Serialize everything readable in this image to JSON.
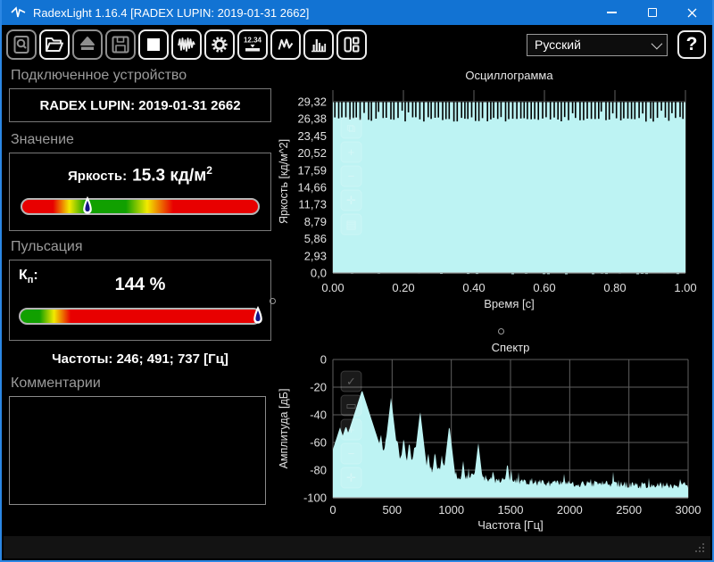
{
  "window": {
    "title": "RadexLight 1.16.4 [RADEX LUPIN: 2019-01-31 2662]",
    "controls": [
      {
        "name": "minimize"
      },
      {
        "name": "maximize"
      },
      {
        "name": "close"
      }
    ]
  },
  "toolbar": {
    "buttons": [
      {
        "name": "report-search",
        "enabled": false
      },
      {
        "name": "open-file",
        "enabled": true
      },
      {
        "name": "eject-device",
        "enabled": false
      },
      {
        "name": "save",
        "enabled": false
      },
      {
        "name": "stop",
        "enabled": true
      },
      {
        "name": "oscillogram-mode",
        "enabled": true
      },
      {
        "name": "settings-gear",
        "enabled": true
      },
      {
        "name": "numeric-display",
        "enabled": true,
        "text": "12.34"
      },
      {
        "name": "waveform-view",
        "enabled": true
      },
      {
        "name": "spectrum-view",
        "enabled": true
      },
      {
        "name": "layout-panels",
        "enabled": true
      }
    ],
    "language": "Русский",
    "help_label": "?"
  },
  "device": {
    "label": "Подключенное устройство",
    "value": "RADEX LUPIN: 2019-01-31 2662"
  },
  "value_section": {
    "label": "Значение",
    "param": "Яркость:",
    "value": "15.3",
    "unit": "кд/м",
    "unit_sup": "2",
    "marker_pos": 0.28
  },
  "pulsation": {
    "label": "Пульсация",
    "kp_main": "К",
    "kp_sub": "п",
    "kp_suffix": ":",
    "value": "144 %",
    "marker_pos": 0.985,
    "freq_text": "Частоты: 246; 491; 737 [Гц]"
  },
  "comments": {
    "label": "Комментарии",
    "text": ""
  },
  "colors": {
    "titlebar": "#1273d3",
    "window_border": "#2b87e4",
    "fill_cyan": "#bdf3f3",
    "grid": "#5f5f5f",
    "axis": "#9a9a9a",
    "green": "#11a000",
    "yellow": "#f2ea00",
    "red": "#e80000"
  },
  "chart_data": [
    {
      "type": "area",
      "title": "Осциллограмма",
      "xlabel": "Время [с]",
      "ylabel": "Яркость [кд/м^2]",
      "xlim": [
        0,
        1
      ],
      "ylim": [
        0,
        29.32
      ],
      "xticks": [
        "0.00",
        "0.20",
        "0.40",
        "0.60",
        "0.80",
        "1.00"
      ],
      "yticks": [
        "29,32",
        "26,38",
        "23,45",
        "20,52",
        "17,59",
        "14,66",
        "11,73",
        "8,79",
        "5,86",
        "2,93",
        "0,0"
      ],
      "grid": true,
      "signal": {
        "description": "dense 246 Hz luminance waveform: solid fill from 0 up to ~29.2 kd/m^2 with narrow notches dipping to ~26",
        "top": 29.22,
        "peak": 29.32,
        "notch_min": 25.9,
        "notch_max": 27.8,
        "n_notches": 95,
        "bottom": 0
      }
    },
    {
      "type": "area",
      "title": "Спектр",
      "xlabel": "Частота [Гц]",
      "ylabel": "Амплитуда [дБ]",
      "xlim": [
        0,
        3000
      ],
      "ylim": [
        -100,
        0
      ],
      "xticks": [
        "0",
        "500",
        "1000",
        "1500",
        "2000",
        "2500",
        "3000"
      ],
      "yticks": [
        "0",
        "-20",
        "-40",
        "-60",
        "-80",
        "-100"
      ],
      "grid": true,
      "envelope": [
        [
          0,
          -72
        ],
        [
          40,
          -66
        ],
        [
          90,
          -64
        ],
        [
          150,
          -62
        ],
        [
          200,
          -55
        ],
        [
          246,
          -43
        ],
        [
          300,
          -58
        ],
        [
          360,
          -65
        ],
        [
          420,
          -68
        ],
        [
          491,
          -60
        ],
        [
          560,
          -73
        ],
        [
          640,
          -76
        ],
        [
          700,
          -73
        ],
        [
          737,
          -70
        ],
        [
          800,
          -79
        ],
        [
          900,
          -81
        ],
        [
          983,
          -79
        ],
        [
          1060,
          -85
        ],
        [
          1200,
          -84
        ],
        [
          1350,
          -87
        ],
        [
          1500,
          -87
        ],
        [
          1700,
          -89
        ],
        [
          2000,
          -90
        ],
        [
          2300,
          -90
        ],
        [
          2600,
          -91
        ],
        [
          3000,
          -91
        ]
      ],
      "peaks": [
        [
          60,
          -49
        ],
        [
          110,
          -48
        ],
        [
          160,
          -48
        ],
        [
          205,
          -50
        ],
        [
          246,
          -22
        ],
        [
          300,
          -48
        ],
        [
          352,
          -54
        ],
        [
          405,
          -53
        ],
        [
          448,
          -56
        ],
        [
          491,
          -27
        ],
        [
          545,
          -57
        ],
        [
          598,
          -56
        ],
        [
          645,
          -59
        ],
        [
          690,
          -61
        ],
        [
          737,
          -37
        ],
        [
          805,
          -67
        ],
        [
          862,
          -66
        ],
        [
          920,
          -69
        ],
        [
          983,
          -47
        ],
        [
          1100,
          -73
        ],
        [
          1228,
          -60
        ],
        [
          1352,
          -79
        ],
        [
          1474,
          -74
        ]
      ]
    }
  ]
}
